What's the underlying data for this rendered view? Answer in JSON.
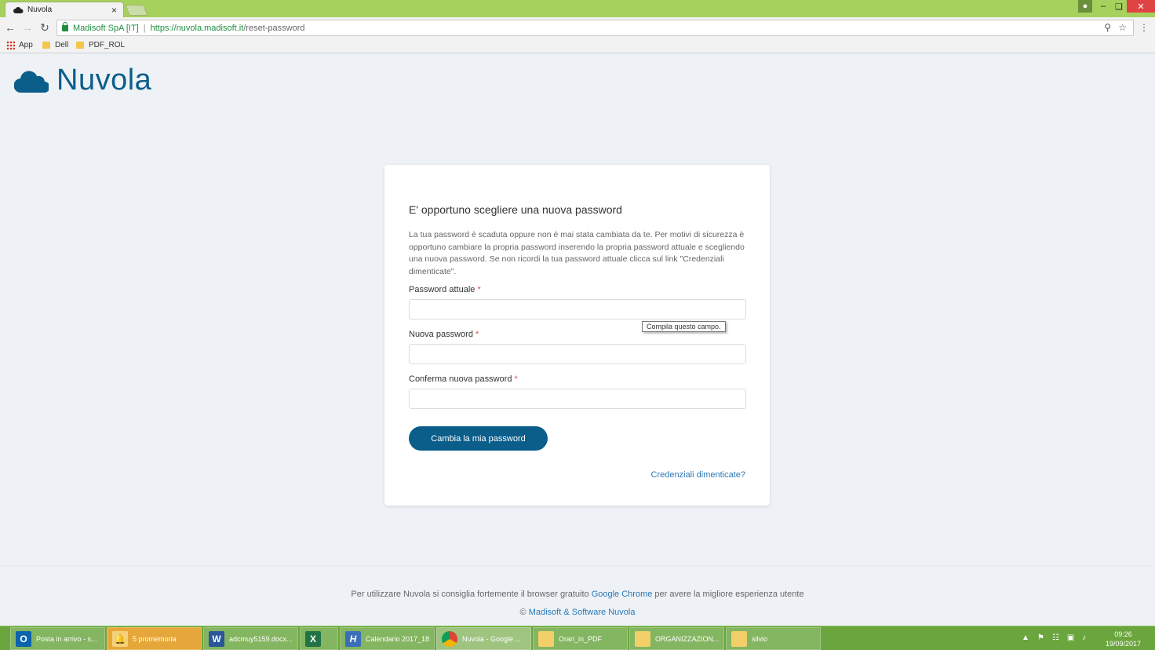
{
  "browser": {
    "tab_title": "Nuvola",
    "tab_close": "×",
    "security_org": "Madisoft SpA [IT]",
    "url_host": "https://nuvola.madisoft.it",
    "url_path": "/reset-password",
    "bookmarks": [
      "App",
      "Dell",
      "PDF_ROL"
    ]
  },
  "logo": {
    "text": "Nuvola",
    "color": "#0b5e8a"
  },
  "form": {
    "title": "E' opportuno scegliere una nuova password",
    "description": "La tua password è scaduta oppure non è mai stata cambiata da te. Per motivi di sicurezza è opportuno cambiare la propria password inserendo la propria password attuale e scegliendo una nuova password. Se non ricordi la tua password attuale clicca sul link \"Credenziali dimenticate\".",
    "fields": [
      {
        "label": "Password attuale",
        "required": "*"
      },
      {
        "label": "Nuova password",
        "required": "*"
      },
      {
        "label": "Conferma nuova password",
        "required": "*"
      }
    ],
    "tooltip": "Compila questo campo.",
    "submit_label": "Cambia la mia password",
    "forgot_link": "Credenziali dimenticate?"
  },
  "footer": {
    "line1_prefix": "Per utilizzare Nuvola si consiglia fortemente il browser gratuito ",
    "line1_link": "Google Chrome",
    "line1_suffix": " per avere la migliore esperienza utente",
    "line2_prefix": "© ",
    "line2_link": "Madisoft & Software Nuvola"
  },
  "taskbar": {
    "items": [
      {
        "label": "Posta in arrivo - s...",
        "icon": "outlook-icon",
        "glyph": "O"
      },
      {
        "label": "5 promemoria",
        "icon": "bell-icon",
        "glyph": "🔔"
      },
      {
        "label": "adcmuy5159.docx...",
        "icon": "word-icon",
        "glyph": "W"
      },
      {
        "label": "",
        "icon": "excel-icon",
        "glyph": "X"
      },
      {
        "label": "Calendario 2017_18",
        "icon": "h-app-icon",
        "glyph": "H"
      },
      {
        "label": "Nuvola - Google ...",
        "icon": "chrome-icon",
        "glyph": ""
      },
      {
        "label": "Orari_in_PDF",
        "icon": "folder-icon",
        "glyph": ""
      },
      {
        "label": "ORGANIZZAZION...",
        "icon": "folder-icon",
        "glyph": ""
      },
      {
        "label": "silvio",
        "icon": "folder-icon",
        "glyph": ""
      }
    ],
    "time": "09:26",
    "date": "19/09/2017"
  }
}
